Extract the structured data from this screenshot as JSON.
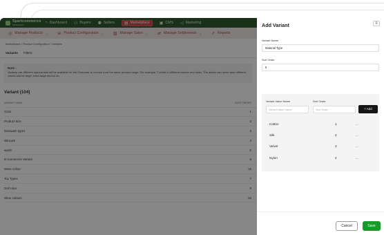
{
  "nav": {
    "brand": "Spartcommerce",
    "brand_sub": "Marketplace",
    "items": [
      {
        "label": "Dashboard",
        "icon": "dashboard-icon"
      },
      {
        "label": "Buyers",
        "icon": "buyers-icon"
      },
      {
        "label": "Sellers",
        "icon": "sellers-icon"
      },
      {
        "label": "Marketplace",
        "icon": "marketplace-icon"
      },
      {
        "label": "CMS",
        "icon": "cms-icon"
      },
      {
        "label": "Marketing",
        "icon": "marketing-icon"
      }
    ]
  },
  "subnav": {
    "items": [
      {
        "label": "Manage Products"
      },
      {
        "label": "Product Configuration"
      },
      {
        "label": "Manage Sales"
      },
      {
        "label": "Manage Settlements"
      },
      {
        "label": "Reports"
      }
    ]
  },
  "breadcrumb": "Marketplace / Product Configuration / Variants",
  "tabs": [
    "Variants",
    "Filters"
  ],
  "note": {
    "title": "Note :",
    "text": "Variants are different options that will be available for the Customer to choose from the same product range. For example, T-shirts in different colours and sizes. The admin can under also different values can be large, extra large and so on."
  },
  "list": {
    "title": "Variant (104)",
    "col_name": "VARIANT NAME",
    "col_order": "SORT ORDER",
    "rows": [
      {
        "name": "Color",
        "order": "1"
      },
      {
        "name": "Product Size",
        "order": "2"
      },
      {
        "name": "facewash types",
        "order": "3"
      },
      {
        "name": "skincare",
        "order": "4"
      },
      {
        "name": "watch",
        "order": "5"
      },
      {
        "name": "E-Commerce Variant",
        "order": "6"
      },
      {
        "name": "Mose colour",
        "order": "16"
      },
      {
        "name": "Toy Types",
        "order": "7"
      },
      {
        "name": "Doll color",
        "order": "9"
      },
      {
        "name": "Shoe colours",
        "order": "10"
      }
    ]
  },
  "panel": {
    "title": "Add Variant",
    "variant_name_label": "Variant Name",
    "variant_name_value": "Material Type",
    "sort_order_label": "Sort Order",
    "sort_order_value": "5",
    "value_header": "Variant Value Name",
    "order_header": "Sort Order",
    "value_placeholder": "Variant Value Name",
    "order_placeholder": "Sort Order",
    "add_label": "+ Add",
    "values": [
      {
        "name": "Cotton",
        "order": "1",
        "more": "..."
      },
      {
        "name": "Silk",
        "order": "2",
        "more": "..."
      },
      {
        "name": "Velvet",
        "order": "3",
        "more": "..."
      },
      {
        "name": "Nylon",
        "order": "4",
        "more": "..."
      }
    ],
    "cancel_label": "Cancel",
    "save_label": "Save"
  }
}
